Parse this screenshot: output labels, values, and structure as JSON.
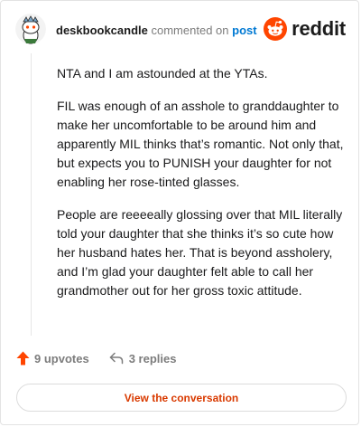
{
  "header": {
    "username": "deskbookcandle",
    "action_text": "commented on",
    "post_link": "post",
    "logo_text": "reddit"
  },
  "comment": {
    "paragraphs": [
      "NTA and I am astounded at the YTAs.",
      "FIL was enough of an asshole to granddaughter to make her uncomfortable to be around him and apparently MIL thinks that’s romantic. Not only that, but expects you to PUNISH your daughter for not enabling her rose-tinted glasses.",
      "People are reeeeally glossing over that MIL literally told your daughter that she thinks it’s so cute how her husband hates her. That is beyond assholery, and I’m glad your daughter felt able to call her grandmother out for her gross toxic attitude."
    ]
  },
  "actions": {
    "upvotes_label": "9 upvotes",
    "replies_label": "3 replies"
  },
  "cta": {
    "label": "View the conversation"
  },
  "colors": {
    "brand": "#ff4500",
    "link": "#0079d3",
    "cta_text": "#d93a00"
  },
  "icons": {
    "avatar": "snoo-avatar",
    "logo": "reddit-snoo-icon",
    "upvote": "upvote-arrow-icon",
    "replies": "reply-arrow-icon"
  }
}
